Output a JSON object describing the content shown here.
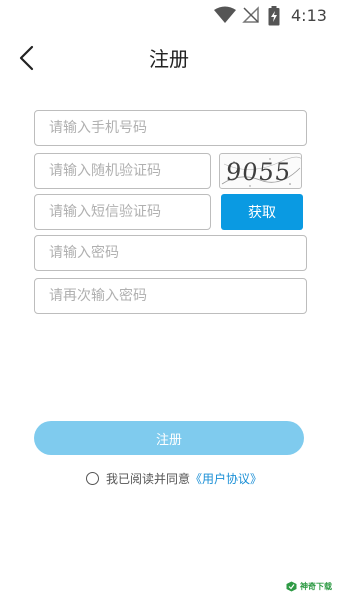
{
  "status_bar": {
    "time": "4:13",
    "icons": [
      "wifi-icon",
      "signal-off-icon",
      "battery-charging-icon"
    ]
  },
  "header": {
    "title": "注册",
    "back_icon": "chevron-left-icon"
  },
  "form": {
    "phone_placeholder": "请输入手机号码",
    "random_code_placeholder": "请输入随机验证码",
    "captcha_text": "9055",
    "sms_code_placeholder": "请输入短信验证码",
    "get_code_label": "获取",
    "password_placeholder": "请输入密码",
    "password_confirm_placeholder": "请再次输入密码"
  },
  "register_label": "注册",
  "agreement": {
    "text": "我已阅读并同意",
    "link": "《用户协议》"
  },
  "watermark": "神奇下载",
  "colors": {
    "accent": "#0a9ae2",
    "register_button": "#7fcbee",
    "link": "#1a8fd6",
    "watermark": "#2e9a44"
  }
}
